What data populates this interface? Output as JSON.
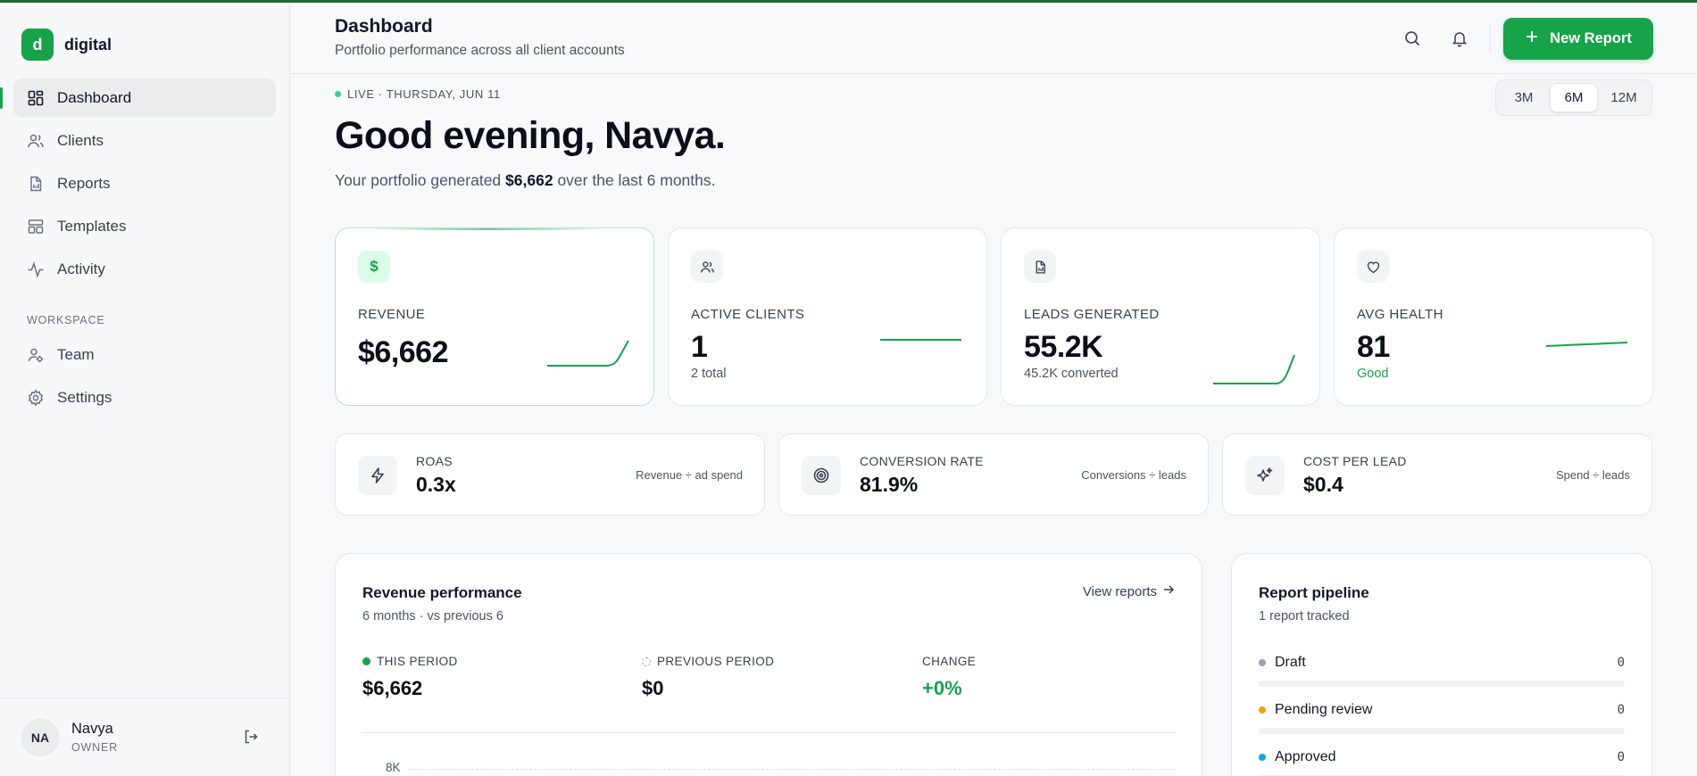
{
  "brand": {
    "logo_letter": "d",
    "name": "digital"
  },
  "nav": {
    "items": [
      {
        "label": "Dashboard",
        "icon": "dashboard-icon",
        "active": true
      },
      {
        "label": "Clients",
        "icon": "users-icon"
      },
      {
        "label": "Reports",
        "icon": "file-icon"
      },
      {
        "label": "Templates",
        "icon": "layout-icon"
      },
      {
        "label": "Activity",
        "icon": "activity-icon"
      }
    ],
    "section_label": "WORKSPACE",
    "workspace_items": [
      {
        "label": "Team",
        "icon": "user-gear-icon"
      },
      {
        "label": "Settings",
        "icon": "gear-icon"
      }
    ]
  },
  "user": {
    "initials": "NA",
    "name": "Navya",
    "role": "OWNER"
  },
  "header": {
    "title": "Dashboard",
    "subtitle": "Portfolio performance across all client accounts",
    "new_report_label": "New Report"
  },
  "hero": {
    "live_text": "LIVE · THURSDAY, JUN 11",
    "greeting": "Good evening, Navya.",
    "summary_prefix": "Your portfolio generated",
    "summary_amount": "$6,662",
    "summary_suffix": "over the last 6 months."
  },
  "range": {
    "options": [
      "3M",
      "6M",
      "12M"
    ],
    "selected": "6M"
  },
  "kpis": [
    {
      "label": "REVENUE",
      "value": "$6,662",
      "foot": "",
      "icon": "dollar-icon",
      "icon_glyph": "$"
    },
    {
      "label": "ACTIVE CLIENTS",
      "value": "1",
      "foot": "2 total",
      "icon": "users-icon"
    },
    {
      "label": "LEADS GENERATED",
      "value": "55.2K",
      "foot": "45.2K converted",
      "icon": "file-icon"
    },
    {
      "label": "AVG HEALTH",
      "value": "81",
      "foot": "Good",
      "icon": "heart-icon"
    }
  ],
  "metrics": [
    {
      "label": "ROAS",
      "value": "0.3x",
      "note": "Revenue ÷ ad spend",
      "icon": "bolt-icon"
    },
    {
      "label": "CONVERSION RATE",
      "value": "81.9%",
      "note": "Conversions ÷ leads",
      "icon": "target-icon"
    },
    {
      "label": "COST PER LEAD",
      "value": "$0.4",
      "note": "Spend ÷ leads",
      "icon": "sparkle-icon"
    }
  ],
  "revenue_card": {
    "title": "Revenue performance",
    "subtitle": "6 months · vs previous 6",
    "link": "View reports",
    "this_label": "THIS PERIOD",
    "this_value": "$6,662",
    "prev_label": "PREVIOUS PERIOD",
    "prev_value": "$0",
    "change_label": "CHANGE",
    "change_value": "+0%",
    "axis_tick": "8K"
  },
  "pipeline": {
    "title": "Report pipeline",
    "subtitle": "1 report tracked",
    "rows": [
      {
        "label": "Draft",
        "count": "0",
        "color": "#9ca3af"
      },
      {
        "label": "Pending review",
        "count": "0",
        "color": "#f59e0b"
      },
      {
        "label": "Approved",
        "count": "0",
        "color": "#0ea5e9"
      }
    ]
  },
  "colors": {
    "accent": "#16a34a",
    "accent_soft": "#dcfce7",
    "positive": "#16a34a"
  }
}
